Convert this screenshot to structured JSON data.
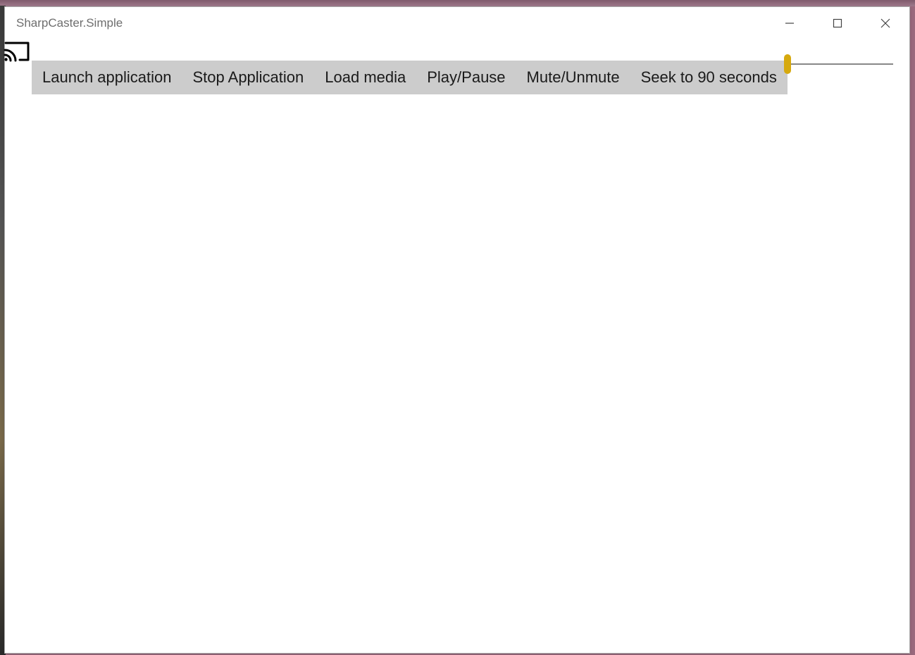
{
  "window": {
    "title": "SharpCaster.Simple"
  },
  "toolbar": {
    "buttons": [
      {
        "label": "Launch application"
      },
      {
        "label": "Stop Application"
      },
      {
        "label": "Load media"
      },
      {
        "label": "Play/Pause"
      },
      {
        "label": "Mute/Unmute"
      },
      {
        "label": "Seek to 90 seconds"
      }
    ]
  },
  "slider": {
    "value": 0,
    "min": 0,
    "max": 100
  }
}
